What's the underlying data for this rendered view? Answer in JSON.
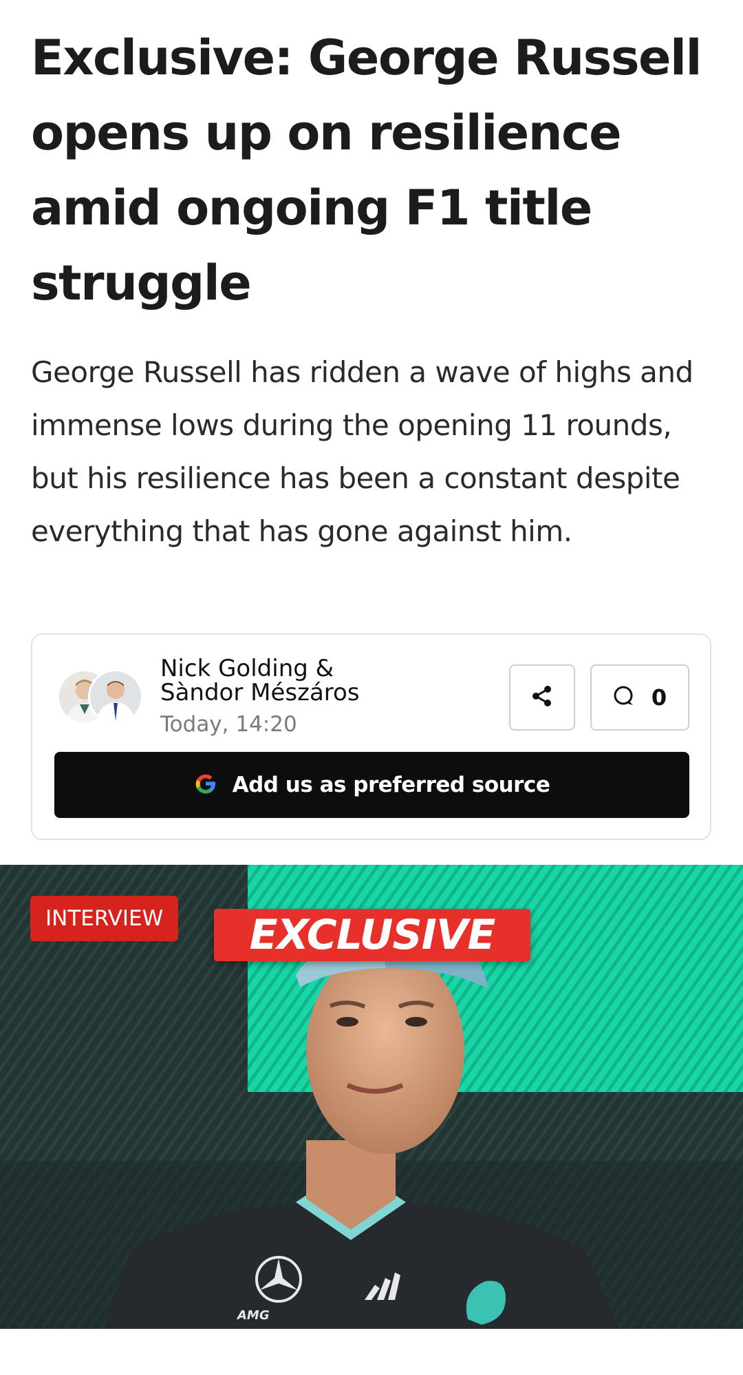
{
  "article": {
    "headline": "Exclusive: George Russell opens up on resilience amid ongoing F1 title struggle",
    "standfirst": "George Russell has ridden a wave of highs and immense lows during the opening 11 rounds, but his resilience has been a constant despite everything that has gone against him."
  },
  "byline": {
    "author_line_1": "Nick Golding &",
    "author_line_2": "Sàndor Mészáros",
    "timestamp": "Today, 14:20",
    "share_icon": "share-icon",
    "comment_icon": "comment-icon",
    "comment_count": "0",
    "preferred_source_label": "Add us as preferred source",
    "preferred_source_icon": "google-g-icon"
  },
  "hero": {
    "category_badge": "INTERVIEW",
    "overlay_label": "EXCLUSIVE",
    "kit_logo_text": "AMG"
  },
  "colors": {
    "badge_red": "#d7231d",
    "button_black": "#0d0d0d",
    "teal_accent": "#18d6a6"
  }
}
